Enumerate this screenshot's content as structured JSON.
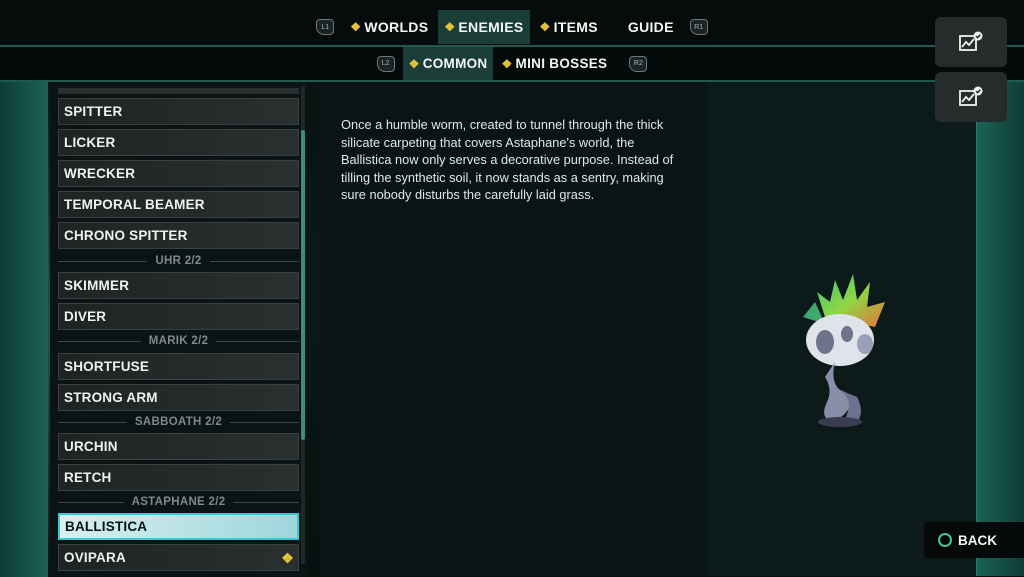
{
  "top_tabs": {
    "left_hint": "L1",
    "right_hint": "R1",
    "items": [
      {
        "label": "WORLDS",
        "diamond": true
      },
      {
        "label": "ENEMIES",
        "diamond": true,
        "active": true
      },
      {
        "label": "ITEMS",
        "diamond": true
      },
      {
        "label": "GUIDE",
        "diamond": false
      }
    ]
  },
  "sub_tabs": {
    "left_hint": "L2",
    "right_hint": "R2",
    "items": [
      {
        "label": "COMMON",
        "active": true
      },
      {
        "label": "MINI BOSSES",
        "active": false
      }
    ]
  },
  "list": {
    "entries": [
      {
        "type": "row",
        "label": "SPITTER"
      },
      {
        "type": "row",
        "label": "LICKER"
      },
      {
        "type": "row",
        "label": "WRECKER"
      },
      {
        "type": "row",
        "label": "TEMPORAL BEAMER"
      },
      {
        "type": "row",
        "label": "CHRONO SPITTER"
      },
      {
        "type": "group",
        "label": "UHR 2/2"
      },
      {
        "type": "row",
        "label": "SKIMMER"
      },
      {
        "type": "row",
        "label": "DIVER"
      },
      {
        "type": "group",
        "label": "MARIK 2/2"
      },
      {
        "type": "row",
        "label": "SHORTFUSE"
      },
      {
        "type": "row",
        "label": "STRONG ARM"
      },
      {
        "type": "group",
        "label": "SABBOATH 2/2"
      },
      {
        "type": "row",
        "label": "URCHIN"
      },
      {
        "type": "row",
        "label": "RETCH"
      },
      {
        "type": "group",
        "label": "ASTAPHANE 2/2"
      },
      {
        "type": "row",
        "label": "BALLISTICA",
        "selected": true
      },
      {
        "type": "row",
        "label": "OVIPARA",
        "new": true
      }
    ]
  },
  "description": "Once a humble worm, created to tunnel through the thick silicate carpeting that covers Astaphane's world, the Ballistica now only serves a decorative purpose. Instead of tilling the synthetic soil, it now stands as a sentry, making sure nobody disturbs the carefully laid grass.",
  "back_label": "BACK",
  "icons": {
    "tab_marker": "diamond-icon",
    "side_buttons": [
      "stats-check-icon",
      "stats-check-icon"
    ],
    "back": "circle-button-icon"
  },
  "colors": {
    "accent_gold": "#e4c23a",
    "selected_cyan": "#3ac8d3",
    "teal_frame": "#1c6355"
  }
}
